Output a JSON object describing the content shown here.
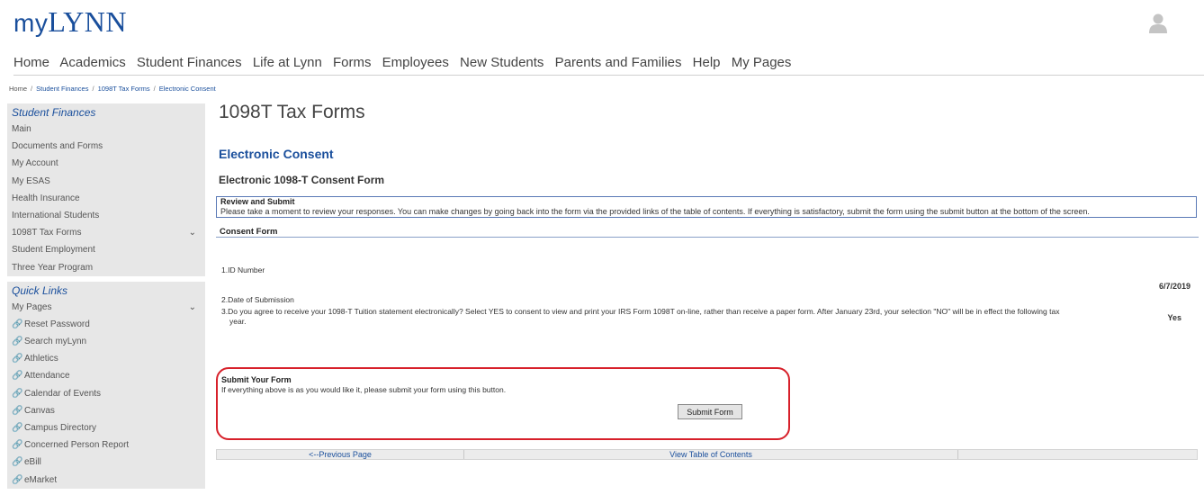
{
  "header": {
    "logo_my": "my",
    "logo_name": "LYNN"
  },
  "topnav": [
    "Home",
    "Academics",
    "Student Finances",
    "Life at Lynn",
    "Forms",
    "Employees",
    "New Students",
    "Parents and Families",
    "Help",
    "My Pages"
  ],
  "breadcrumb": {
    "home": "Home",
    "sep": "/",
    "items": [
      "Student Finances",
      "1098T Tax Forms",
      "Electronic Consent"
    ]
  },
  "sidebar": {
    "student_finances": {
      "title": "Student Finances",
      "items": [
        "Main",
        "Documents and Forms",
        "My Account",
        "My ESAS",
        "Health Insurance",
        "International Students",
        "1098T Tax Forms",
        "Student Employment",
        "Three Year Program"
      ]
    },
    "quick_links": {
      "title": "Quick Links",
      "items": [
        "My Pages",
        "Reset Password",
        "Search myLynn",
        "Athletics",
        "Attendance",
        "Calendar of Events",
        "Canvas",
        "Campus Directory",
        "Concerned Person Report",
        "eBill",
        "eMarket"
      ]
    },
    "link_icon": "link-icon",
    "chevron_icon": "chevron-down-icon"
  },
  "main": {
    "page_title": "1098T Tax Forms",
    "section_title": "Electronic Consent",
    "form_title": "Electronic 1098-T Consent Form",
    "review": {
      "heading": "Review and Submit",
      "text": "Please take a moment to review your responses. You can make changes by going back into the form via the provided links of the table of contents. If everything is satisfactory, submit the form using the submit button at the bottom of the screen."
    },
    "consent_label": "Consent Form",
    "questions": [
      {
        "label": "1.ID Number",
        "answer": ""
      },
      {
        "label": "2.Date of Submission",
        "answer": "6/7/2019"
      },
      {
        "label": "3.Do you agree to receive your 1098-T Tuition statement electronically?   Select YES to consent to view and print your IRS Form 1098T on-line, rather than receive a paper form. After January 23rd,  your selection \"NO\" will be in effect  the following tax",
        "label_cont": "year.",
        "answer": "Yes"
      }
    ],
    "submit": {
      "heading": "Submit Your Form",
      "text": "If everything above is as you would like it, please submit your form using this button.",
      "button": "Submit Form",
      "highlight_color": "#d7202a"
    },
    "bottom_nav": {
      "previous": "<--Previous Page",
      "toc": "View Table of Contents",
      "next": ""
    }
  },
  "colors": {
    "brand_blue": "#1a4f9c",
    "sidebar_bg": "#e7e7e7"
  }
}
